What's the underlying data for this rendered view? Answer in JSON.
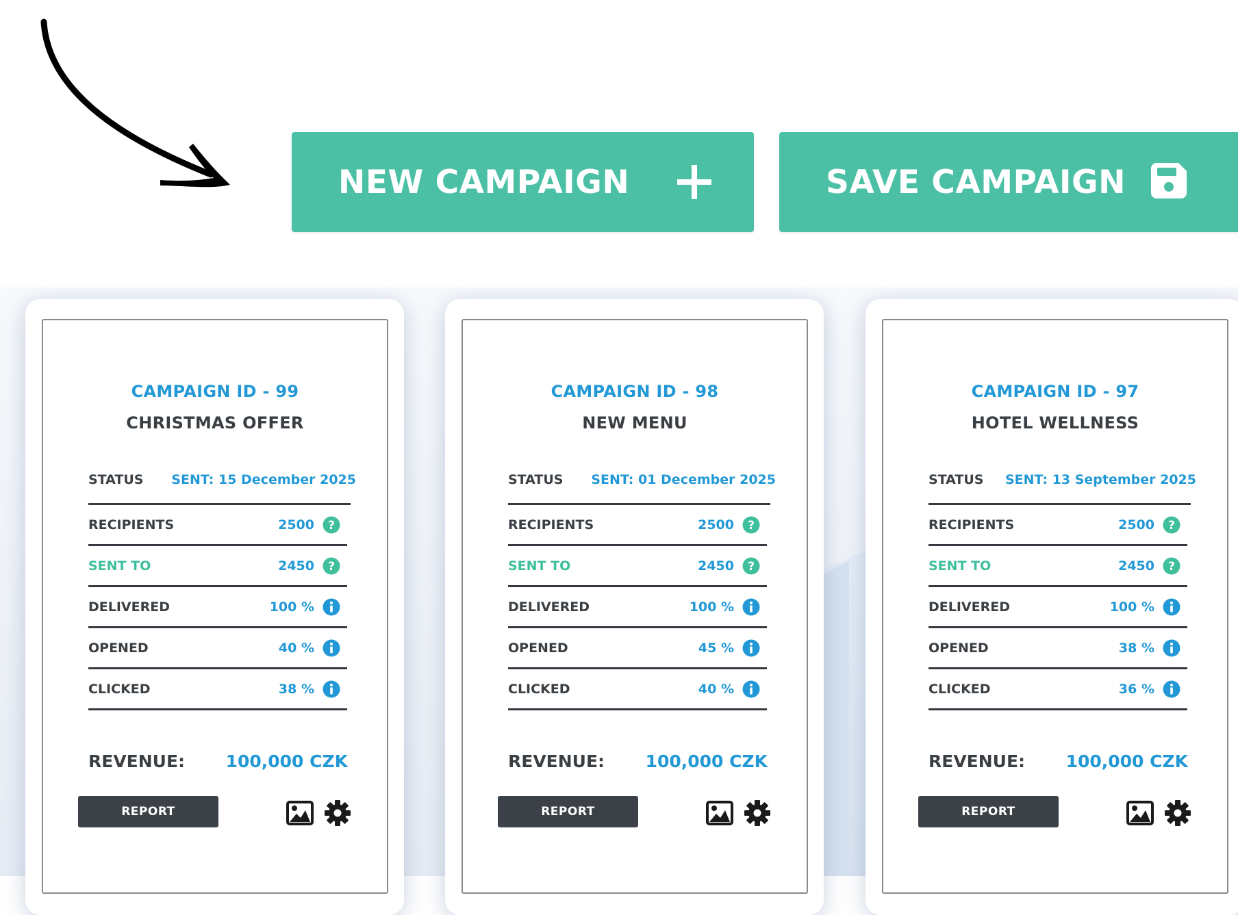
{
  "colors": {
    "accent_green": "#4bc0a5",
    "id_blue": "#2299d6",
    "dark_text": "#3a3f44",
    "sent_to_teal": "#3fbf9b",
    "report_button": "#3b4146"
  },
  "toolbar": {
    "new_campaign_label": "NEW CAMPAIGN",
    "new_campaign_icon": "plus-icon",
    "save_campaign_label": "SAVE CAMPAIGN",
    "save_campaign_icon": "floppy-disk-icon"
  },
  "cards": [
    {
      "id_label": "CAMPAIGN ID - 99",
      "name": "CHRISTMAS OFFER",
      "status_label": "STATUS",
      "status_value": "SENT: 15 December 2025",
      "stats": [
        {
          "label": "RECIPIENTS",
          "value": "2500",
          "icon": "question-icon"
        },
        {
          "label": "SENT TO",
          "value": "2450",
          "icon": "question-icon"
        },
        {
          "label": "DELIVERED",
          "value": "100 %",
          "icon": "info-icon"
        },
        {
          "label": "OPENED",
          "value": "40 %",
          "icon": "info-icon"
        },
        {
          "label": "CLICKED",
          "value": "38 %",
          "icon": "info-icon"
        }
      ],
      "revenue_label": "REVENUE:",
      "revenue_value": "100,000 CZK",
      "report_label": "REPORT"
    },
    {
      "id_label": "CAMPAIGN ID - 98",
      "name": "NEW MENU",
      "status_label": "STATUS",
      "status_value": "SENT: 01 December 2025",
      "stats": [
        {
          "label": "RECIPIENTS",
          "value": "2500",
          "icon": "question-icon"
        },
        {
          "label": "SENT TO",
          "value": "2450",
          "icon": "question-icon"
        },
        {
          "label": "DELIVERED",
          "value": "100 %",
          "icon": "info-icon"
        },
        {
          "label": "OPENED",
          "value": "45 %",
          "icon": "info-icon"
        },
        {
          "label": "CLICKED",
          "value": "40 %",
          "icon": "info-icon"
        }
      ],
      "revenue_label": "REVENUE:",
      "revenue_value": "100,000 CZK",
      "report_label": "REPORT"
    },
    {
      "id_label": "CAMPAIGN ID - 97",
      "name": "HOTEL WELLNESS",
      "status_label": "STATUS",
      "status_value": "SENT: 13 September 2025",
      "stats": [
        {
          "label": "RECIPIENTS",
          "value": "2500",
          "icon": "question-icon"
        },
        {
          "label": "SENT TO",
          "value": "2450",
          "icon": "question-icon"
        },
        {
          "label": "DELIVERED",
          "value": "100 %",
          "icon": "info-icon"
        },
        {
          "label": "OPENED",
          "value": "38 %",
          "icon": "info-icon"
        },
        {
          "label": "CLICKED",
          "value": "36 %",
          "icon": "info-icon"
        }
      ],
      "revenue_label": "REVENUE:",
      "revenue_value": "100,000 CZK",
      "report_label": "REPORT"
    }
  ]
}
